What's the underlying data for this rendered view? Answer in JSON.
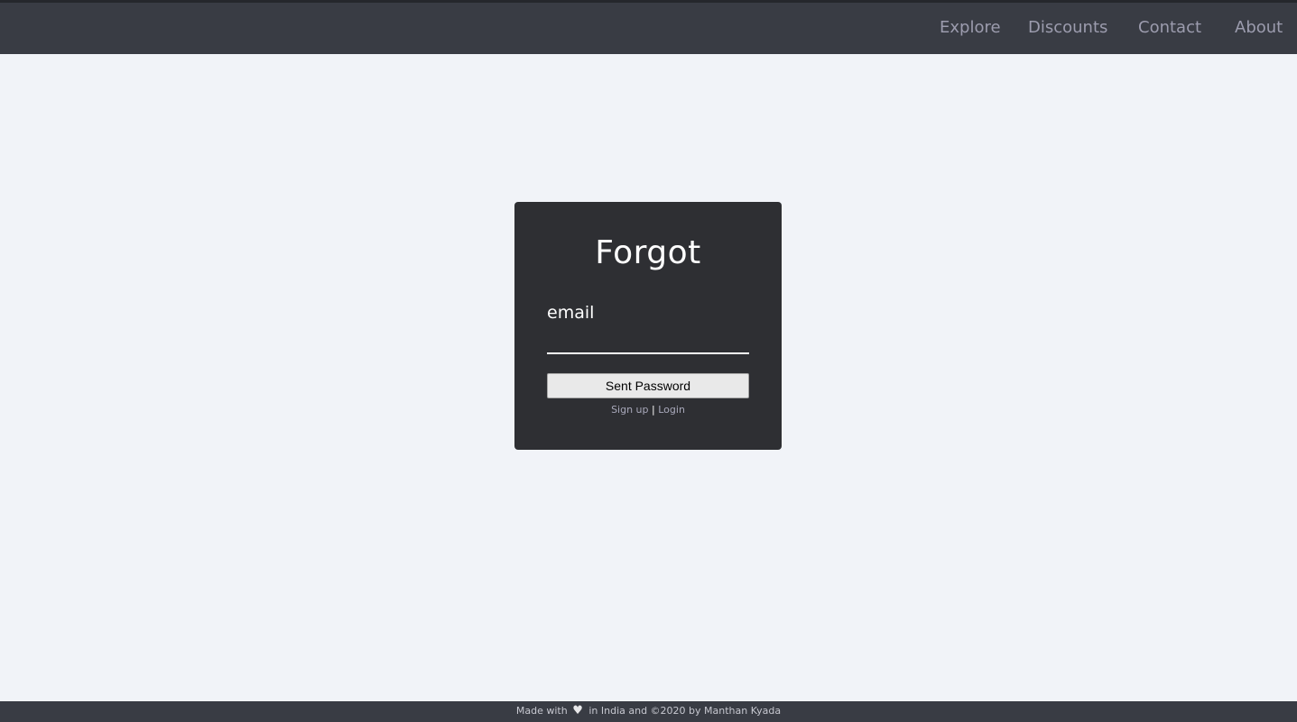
{
  "nav": {
    "links": [
      {
        "label": "Explore"
      },
      {
        "label": "Discounts"
      },
      {
        "label": "Contact"
      },
      {
        "label": "About"
      }
    ]
  },
  "card": {
    "title": "Forgot",
    "email_label": "email",
    "email_value": "",
    "submit_label": "Sent Password",
    "signup_label": "Sign up",
    "separator": "|",
    "login_label": "Login"
  },
  "footer": {
    "prefix": "Made with",
    "heart_icon": "heart-icon",
    "suffix": "in India and ©2020 by Manthan Kyada"
  },
  "colors": {
    "header_bg": "#393c44",
    "page_bg": "#f1f3f8",
    "card_bg": "#2e2f33",
    "nav_text": "#9c9cae"
  }
}
